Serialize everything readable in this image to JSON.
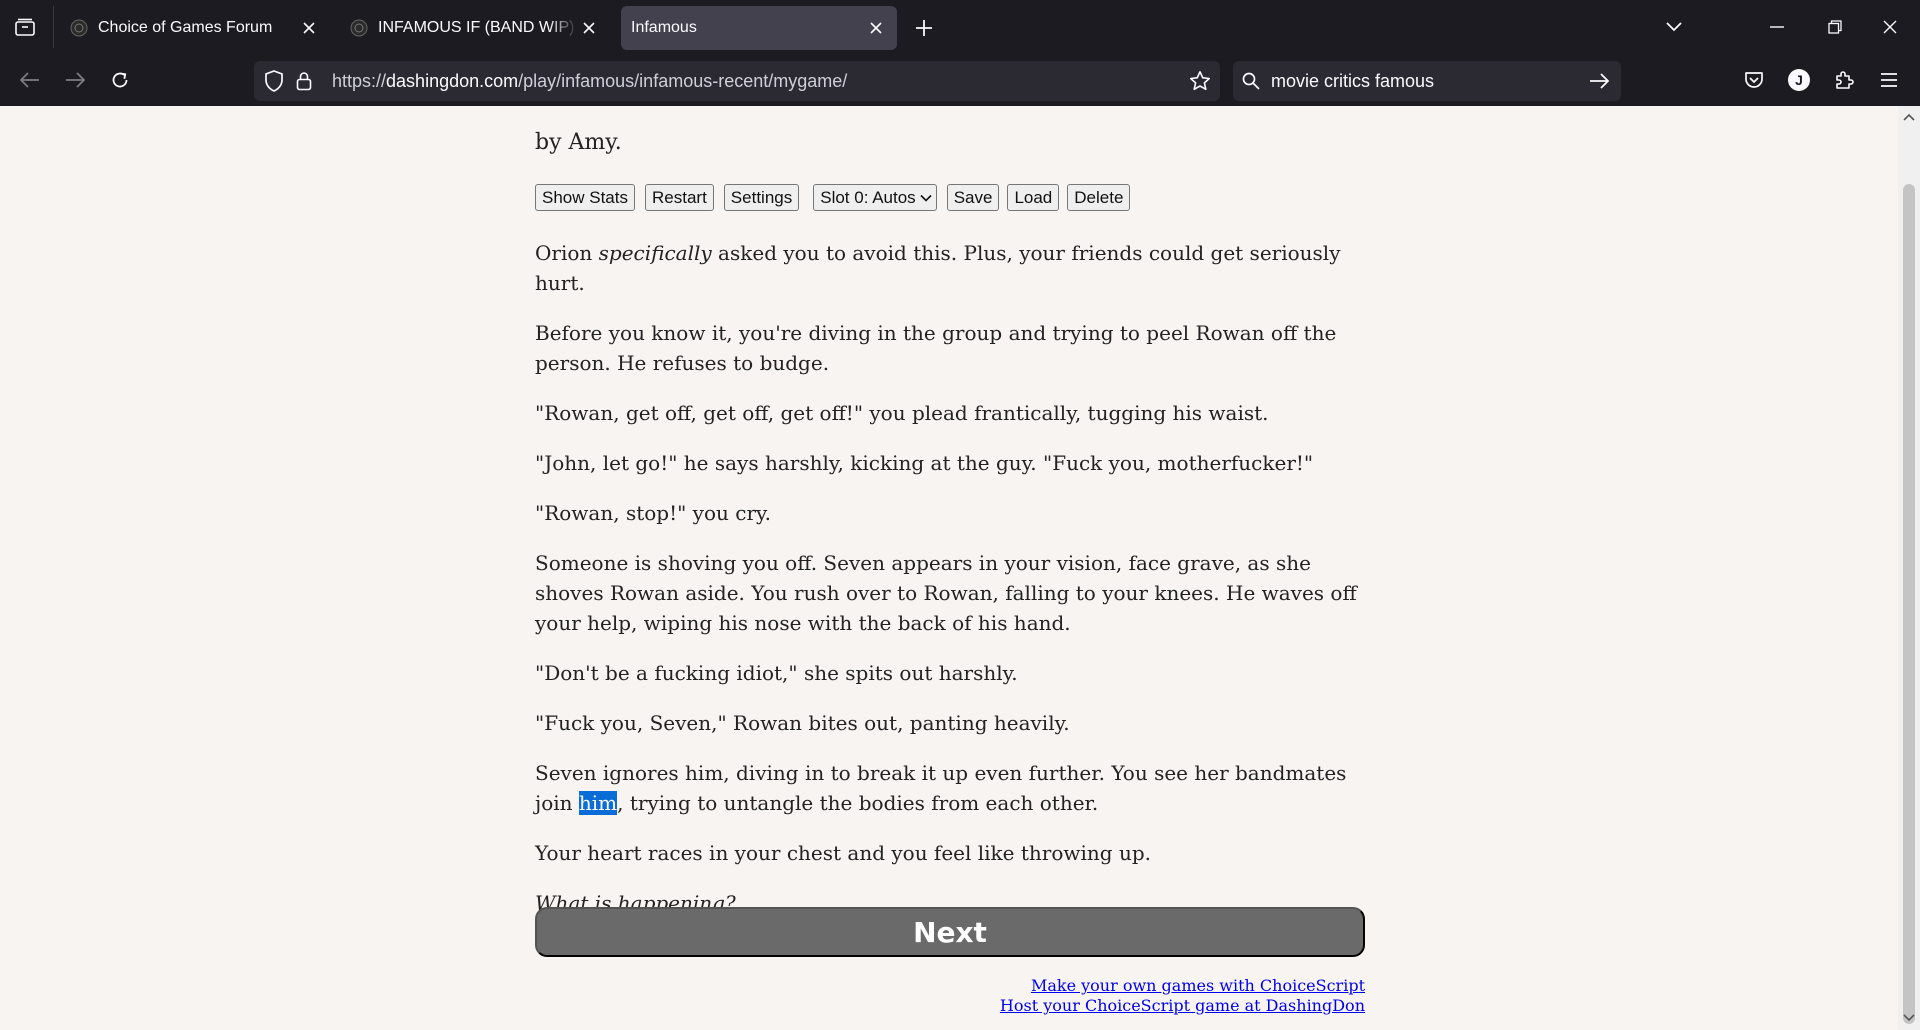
{
  "browser": {
    "tabs": [
      {
        "title": "Choice of Games Forum",
        "active": false
      },
      {
        "title": "INFAMOUS IF (BAND WIP) CHAPTER",
        "active": false
      },
      {
        "title": "Infamous",
        "active": true
      }
    ],
    "url": {
      "scheme": "https://",
      "host": "dashingdon.com",
      "path": "/play/infamous/infamous-recent/mygame/"
    },
    "search_value": "movie critics famous",
    "profile_initial": "J"
  },
  "game": {
    "byline": "by Amy.",
    "buttons": {
      "show_stats": "Show Stats",
      "restart": "Restart",
      "settings": "Settings",
      "slot": "Slot 0: Autos",
      "save": "Save",
      "load": "Load",
      "delete": "Delete"
    },
    "paragraphs": {
      "p1_before": "Orion ",
      "p1_emph": "specifically",
      "p1_after": " asked you to avoid this. Plus, your friends could get seriously hurt.",
      "p2": "Before you know it, you're diving in the group and trying to peel Rowan off the person. He refuses to budge.",
      "p3": "\"Rowan, get off, get off, get off!\" you plead frantically, tugging his waist.",
      "p4": "\"John, let go!\" he says harshly, kicking at the guy. \"Fuck you, motherfucker!\"",
      "p5": "\"Rowan, stop!\" you cry.",
      "p6": "Someone is shoving you off. Seven appears in your vision, face grave, as she shoves Rowan aside. You rush over to Rowan, falling to your knees. He waves off your help, wiping his nose with the back of his hand.",
      "p7": "\"Don't be a fucking idiot,\" she spits out harshly.",
      "p8": "\"Fuck you, Seven,\" Rowan bites out, panting heavily.",
      "p9_before": "Seven ignores him, diving in to break it up even further. You see her bandmates join ",
      "p9_highlight": "him",
      "p9_after": ", trying to untangle the bodies from each other.",
      "p10": "Your heart races in your chest and you feel like throwing up.",
      "p11": "What is happening?"
    },
    "next_label": "Next",
    "footer_links": {
      "make_games": "Make your own games with ChoiceScript",
      "host_games": "Host your ChoiceScript game at DashingDon"
    }
  }
}
